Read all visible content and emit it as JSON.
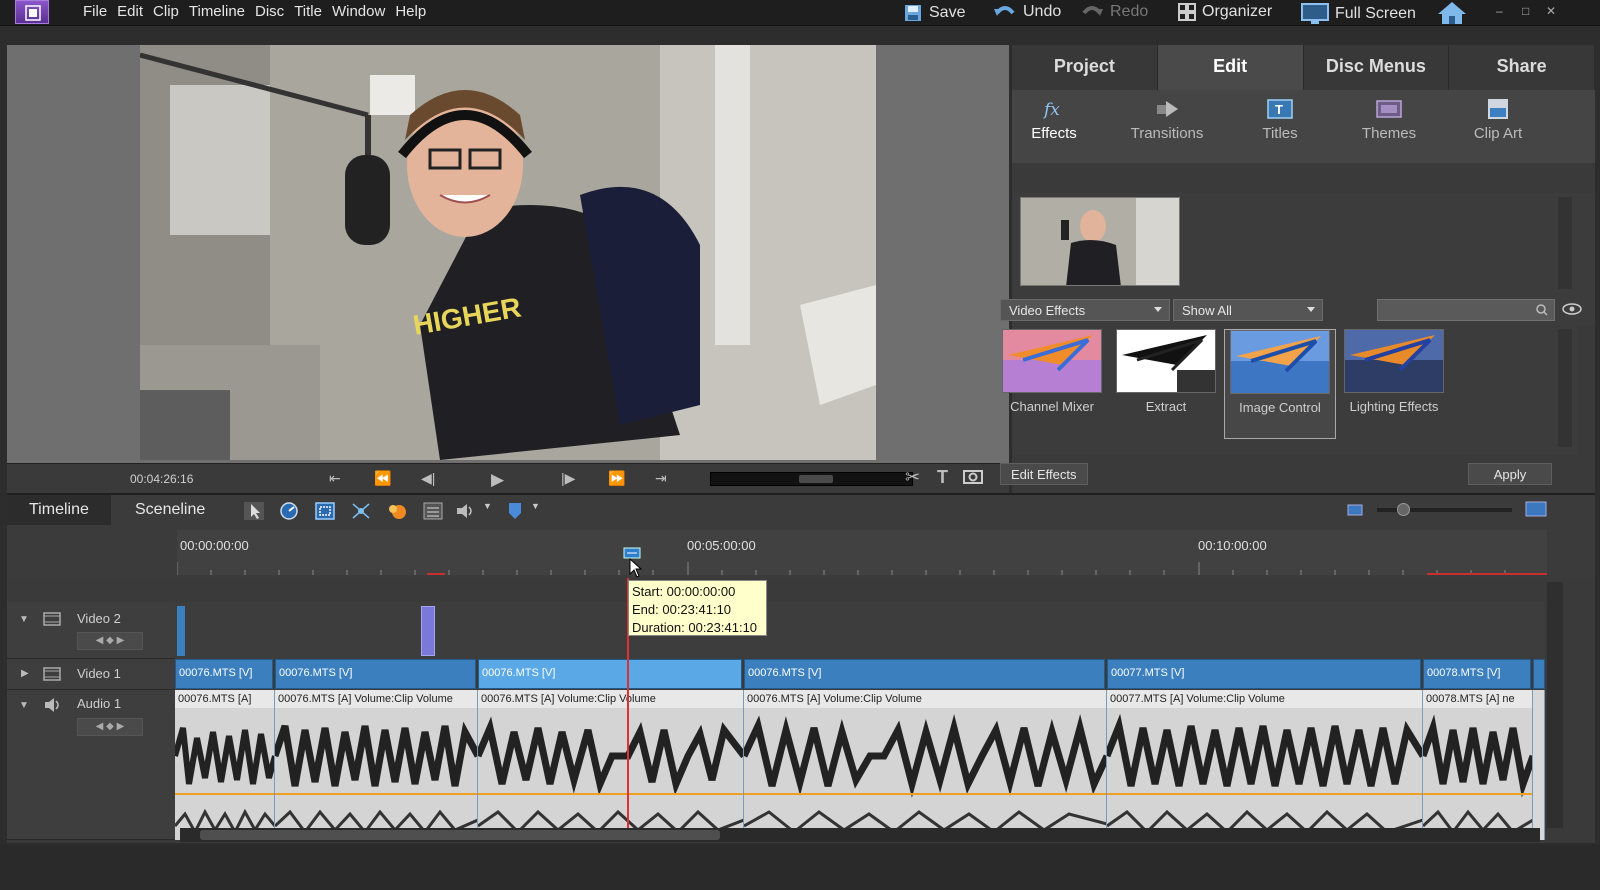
{
  "menubar": {
    "items": [
      "File",
      "Edit",
      "Clip",
      "Timeline",
      "Disc",
      "Title",
      "Window",
      "Help"
    ],
    "save": "Save",
    "undo": "Undo",
    "redo": "Redo",
    "organizer": "Organizer",
    "fullscreen": "Full Screen"
  },
  "monitor": {
    "timecode": "00:04:26:16"
  },
  "panel": {
    "tabs": [
      "Project",
      "Edit",
      "Disc Menus",
      "Share"
    ],
    "active_tab": "Edit",
    "tools": [
      "Effects",
      "Transitions",
      "Titles",
      "Themes",
      "Clip Art"
    ],
    "active_tool": "Effects",
    "category_dropdown": "Video Effects",
    "filter_dropdown": "Show All",
    "effects": [
      "Channel Mixer",
      "Extract",
      "Image Control",
      "Lighting Effects"
    ],
    "selected_effect": "Image Control",
    "edit_effects_button": "Edit Effects",
    "apply_button": "Apply"
  },
  "timeline": {
    "tabs": [
      "Timeline",
      "Sceneline"
    ],
    "active_tab": "Timeline",
    "ruler_labels": [
      "00:00:00:00",
      "00:05:00:00",
      "00:10:00:00"
    ],
    "tracks": {
      "video2": "Video 2",
      "video1": "Video 1",
      "audio1": "Audio 1"
    },
    "video_clips": [
      "00076.MTS [V]",
      "00076.MTS [V]",
      "00076.MTS [V]",
      "00076.MTS [V]",
      "00077.MTS [V]",
      "00078.MTS [V]"
    ],
    "audio_clips": [
      "00076.MTS [A]",
      "00076.MTS [A]  Volume:Clip Volume",
      "00076.MTS [A]  Volume:Clip Volume",
      "00076.MTS [A]  Volume:Clip Volume",
      "00077.MTS [A]  Volume:Clip Volume",
      "00078.MTS [A]  ne"
    ],
    "tooltip": {
      "start": "Start: 00:00:00:00",
      "end": "End: 00:23:41:10",
      "duration": "Duration: 00:23:41:10"
    }
  },
  "colors": {
    "accent": "#3b7fbf",
    "selected_clip": "#5aa8e6",
    "playhead": "#e03030",
    "tooltip_bg": "#ffffcc"
  }
}
